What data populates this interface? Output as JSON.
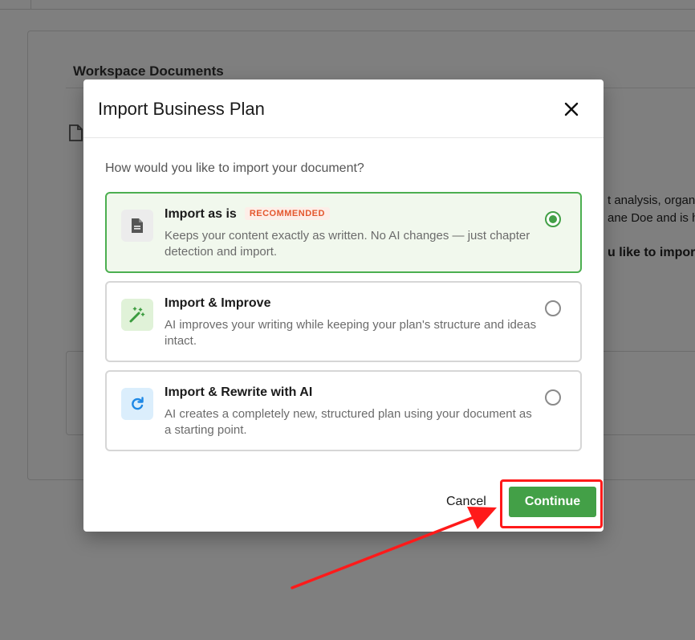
{
  "background": {
    "section_heading": "Workspace Documents",
    "snippet_line1": "t analysis, organiz",
    "snippet_line2": "ane Doe and is hea",
    "snippet_line3": "u like to import"
  },
  "modal": {
    "title": "Import Business Plan",
    "question": "How would you like to import your document?",
    "options": [
      {
        "title": "Import as is",
        "badge": "RECOMMENDED",
        "description": "Keeps your content exactly as written. No AI changes — just chapter detection and import.",
        "icon": "document-icon",
        "selected": true
      },
      {
        "title": "Import & Improve",
        "description": "AI improves your writing while keeping your plan's structure and ideas intact.",
        "icon": "magic-wand-icon",
        "selected": false
      },
      {
        "title": "Import & Rewrite with AI",
        "description": "AI creates a completely new, structured plan using your document as a starting point.",
        "icon": "refresh-icon",
        "selected": false
      }
    ],
    "cancel_label": "Cancel",
    "continue_label": "Continue"
  },
  "colors": {
    "accent_green": "#43a047",
    "selected_bg": "#f1f8ed",
    "badge_text": "#e4572e",
    "annotation_red": "#ff1a1a"
  }
}
